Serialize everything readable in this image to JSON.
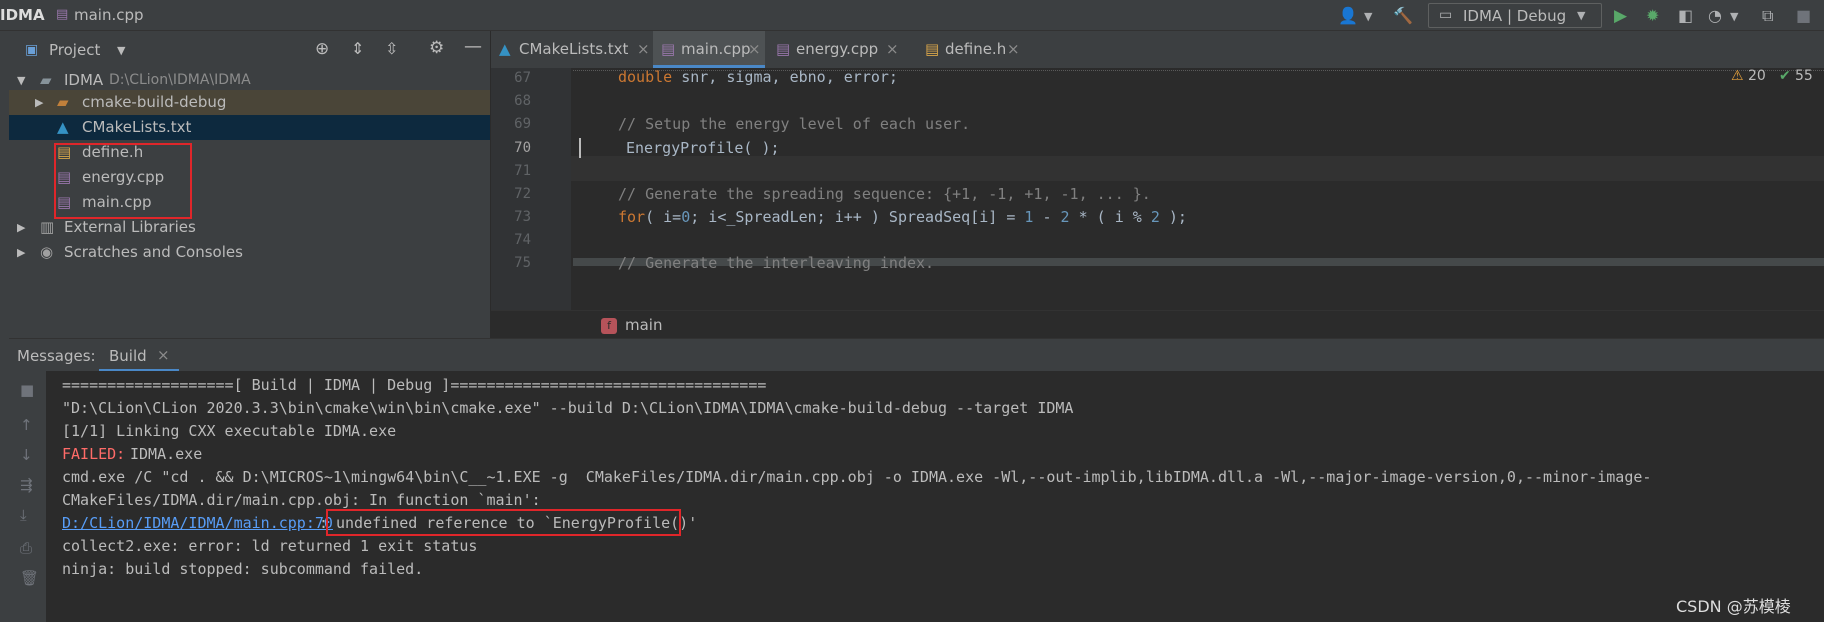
{
  "titlebar": {
    "project": "IDMA",
    "file": "main.cpp",
    "run_config": "IDMA | Debug"
  },
  "project_panel": {
    "title": "Project",
    "tree": [
      {
        "label": "IDMA",
        "path": "D:\\CLion\\IDMA\\IDMA"
      },
      {
        "label": "cmake-build-debug"
      },
      {
        "label": "CMakeLists.txt"
      },
      {
        "label": "define.h"
      },
      {
        "label": "energy.cpp"
      },
      {
        "label": "main.cpp"
      },
      {
        "label": "External Libraries"
      },
      {
        "label": "Scratches and Consoles"
      }
    ]
  },
  "tabs": [
    {
      "label": "CMakeLists.txt"
    },
    {
      "label": "main.cpp"
    },
    {
      "label": "energy.cpp"
    },
    {
      "label": "define.h"
    }
  ],
  "inspections": {
    "warnings": "20",
    "ok": "55"
  },
  "editor": {
    "line_numbers": [
      "67",
      "68",
      "69",
      "70",
      "71",
      "72",
      "73",
      "74",
      "75"
    ],
    "breadcrumb_function": "main",
    "breadcrumb_badge": "f"
  },
  "messages": {
    "label": "Messages:",
    "tab": "Build",
    "lines": [
      "===================[ Build | IDMA | Debug ]===================================",
      "\"D:\\CLion\\CLion 2020.3.3\\bin\\cmake\\win\\bin\\cmake.exe\" --build D:\\CLion\\IDMA\\IDMA\\cmake-build-debug --target IDMA",
      "[1/1] Linking CXX executable IDMA.exe",
      "IDMA.exe",
      "cmd.exe /C \"cd . && D:\\MICROS~1\\mingw64\\bin\\C__~1.EXE -g  CMakeFiles/IDMA.dir/main.cpp.obj -o IDMA.exe -Wl,--out-implib,libIDMA.dll.a -Wl,--major-image-version,0,--minor-image-",
      "CMakeFiles/IDMA.dir/main.cpp.obj: In function `main':",
      "undefined reference to `EnergyProfile()'",
      "collect2.exe: error: ld returned 1 exit status",
      "ninja: build stopped: subcommand failed."
    ],
    "failed_label": "FAILED:",
    "error_link": "D:/CLion/IDMA/IDMA/main.cpp:70",
    "error_sep": ":"
  },
  "watermark": "CSDN @苏模棱"
}
